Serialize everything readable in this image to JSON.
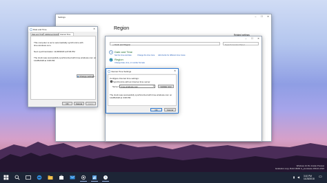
{
  "settings_window": {
    "title": "Settings",
    "heading": "Region",
    "related_settings": "Related settings"
  },
  "control_panel": {
    "breadcrumb": "« Clock and Region",
    "search_placeholder": "Search Control Panel",
    "date_time": {
      "title": "Date and Time",
      "links": [
        "Set the time and date",
        "Change the time zone",
        "Add clocks for different time zones"
      ]
    },
    "region": {
      "title": "Region",
      "links": [
        "Change date, time, or number formats"
      ]
    }
  },
  "date_time_dialog": {
    "title": "Date and Time",
    "tabs": [
      "Date and Time",
      "Additional Clocks",
      "Internet Time"
    ],
    "sync_text_1": "This computer is set to automatically synchronize with",
    "sync_text_2": "time.windows.com.",
    "next_sync": "Next synchronization: 11/28/2018 at 8:06 PM",
    "last_sync_1": "The clock was successfully synchronized with time.windows.com on",
    "last_sync_2": "11/28/2018 at 3:08 PM.",
    "change_settings": "Change settings...",
    "ok": "OK",
    "cancel": "Cancel",
    "apply": "Apply"
  },
  "internet_time_dialog": {
    "title": "Internet Time Settings",
    "configure_label": "Configure Internet time settings:",
    "sync_checkbox_label": "Synchronize with an Internet time server",
    "server_label": "Server:",
    "server_value": "time.windows.com",
    "update_now": "Update now",
    "result_1": "The clock was successfully synchronized with time.windows.com on",
    "result_2": "11/28/2018 at 3:08 PM.",
    "ok": "OK",
    "cancel": "Cancel"
  },
  "watermark": {
    "line1": "Windows 10 Pro Insider Preview",
    "line2": "Evaluation copy. Build 18290.rs_prerelease.181121-1524"
  },
  "taskbar": {
    "time": "3:10 PM",
    "date": "11/28/2018",
    "icons": [
      "start-icon",
      "search-icon",
      "task-view-icon",
      "edge-icon",
      "file-explorer-icon",
      "store-icon",
      "mail-icon",
      "settings-icon",
      "control-panel-icon",
      "date-time-icon"
    ]
  },
  "colors": {
    "accent": "#0078d7",
    "taskbar": "#1d2536",
    "link": "#1a57b8",
    "sky_top": "#d0dcf5",
    "sky_pink": "#d6a0c9"
  }
}
